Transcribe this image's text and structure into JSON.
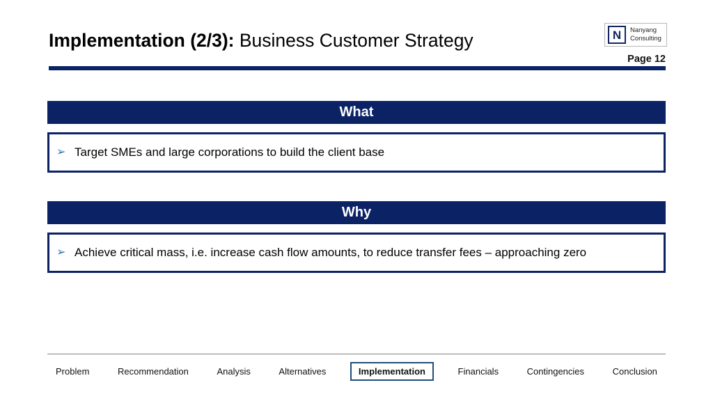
{
  "slide": {
    "title_strong": "Implementation (2/3):",
    "title_rest": " Business Customer Strategy",
    "page_label": "Page 12"
  },
  "logo": {
    "mark_letter": "N",
    "line1": "Nanyang",
    "line2": "Consulting"
  },
  "sections": [
    {
      "header": "What",
      "bullet_glyph": "➢",
      "bullet_text": "Target SMEs and large corporations to build the client base"
    },
    {
      "header": "Why",
      "bullet_glyph": "➢",
      "bullet_text": "Achieve critical mass, i.e. increase cash flow amounts, to reduce transfer fees – approaching zero"
    }
  ],
  "footer_nav": {
    "items": [
      {
        "label": "Problem",
        "active": false
      },
      {
        "label": "Recommendation",
        "active": false
      },
      {
        "label": "Analysis",
        "active": false
      },
      {
        "label": "Alternatives",
        "active": false
      },
      {
        "label": "Implementation",
        "active": true
      },
      {
        "label": "Financials",
        "active": false
      },
      {
        "label": "Contingencies",
        "active": false
      },
      {
        "label": "Conclusion",
        "active": false
      }
    ]
  },
  "colors": {
    "navy": "#0b2265",
    "bullet_blue": "#2e74b5",
    "active_border": "#1f4e79",
    "rule_gray": "#808080"
  }
}
